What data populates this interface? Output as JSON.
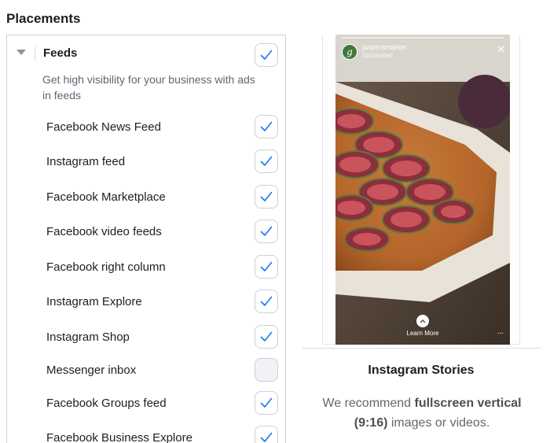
{
  "section_title": "Placements",
  "group": {
    "label": "Feeds",
    "description": "Get high visibility for your business with ads in feeds",
    "checked": true
  },
  "placements": [
    {
      "label": "Facebook News Feed",
      "checked": true
    },
    {
      "label": "Instagram feed",
      "checked": true
    },
    {
      "label": "Facebook Marketplace",
      "checked": true
    },
    {
      "label": "Facebook video feeds",
      "checked": true
    },
    {
      "label": "Facebook right column",
      "checked": true
    },
    {
      "label": "Instagram Explore",
      "checked": true
    },
    {
      "label": "Instagram Shop",
      "checked": true
    },
    {
      "label": "Messenger inbox",
      "checked": false
    },
    {
      "label": "Facebook Groups feed",
      "checked": true
    },
    {
      "label": "Facebook Business Explore",
      "checked": true
    }
  ],
  "preview": {
    "account_name": "jaspersmarket",
    "sponsored": "Sponsored",
    "avatar_letter": "g",
    "cta": "Learn More",
    "more": "...",
    "title": "Instagram Stories",
    "desc_pre": "We recommend ",
    "desc_bold1": "fullscreen vertical",
    "desc_bold2": "(9:16)",
    "desc_post": " images or videos."
  },
  "colors": {
    "check": "#1877f2",
    "border": "#ccd0d5",
    "disabled_bg": "#f0f2f5"
  }
}
